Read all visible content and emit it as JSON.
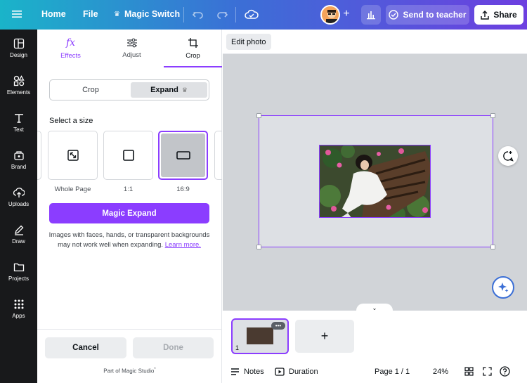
{
  "topbar": {
    "home": "Home",
    "file": "File",
    "magic_switch": "Magic Switch",
    "send_to_teacher": "Send to teacher",
    "share": "Share"
  },
  "rail": [
    {
      "label": "Design",
      "icon": "layout-icon"
    },
    {
      "label": "Elements",
      "icon": "shapes-icon"
    },
    {
      "label": "Text",
      "icon": "text-icon"
    },
    {
      "label": "Brand",
      "icon": "brand-icon"
    },
    {
      "label": "Uploads",
      "icon": "upload-icon"
    },
    {
      "label": "Draw",
      "icon": "pen-icon"
    },
    {
      "label": "Projects",
      "icon": "folder-icon"
    },
    {
      "label": "Apps",
      "icon": "apps-icon"
    }
  ],
  "panel": {
    "tabs": [
      {
        "label": "Effects",
        "icon": "fx-icon"
      },
      {
        "label": "Adjust",
        "icon": "sliders-icon"
      },
      {
        "label": "Crop",
        "icon": "crop-icon"
      }
    ],
    "segment": {
      "crop": "Crop",
      "expand": "Expand"
    },
    "section_title": "Select a size",
    "sizes": [
      {
        "label": "Whole Page"
      },
      {
        "label": "1:1"
      },
      {
        "label": "16:9"
      }
    ],
    "magic_expand": "Magic Expand",
    "note": "Images with faces, hands, or transparent backgrounds may not work well when expanding.",
    "learn_more": "Learn more.",
    "cancel": "Cancel",
    "done": "Done",
    "studio": "Part of Magic Studio"
  },
  "canvas": {
    "edit_photo": "Edit photo"
  },
  "pages": {
    "thumb_number": "1",
    "add": "+"
  },
  "bottom": {
    "notes": "Notes",
    "duration": "Duration",
    "page": "Page 1 / 1",
    "zoom": "24%"
  }
}
